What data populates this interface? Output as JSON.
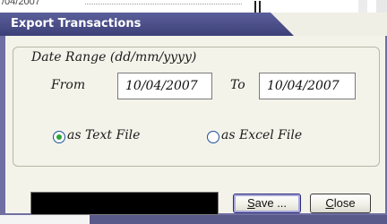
{
  "background": {
    "partial_text": "/04/2007"
  },
  "dialog": {
    "title": "Export Transactions",
    "date_range": {
      "legend": "Date Range (dd/mm/yyyy)",
      "from_label": "From",
      "from_value": "10/04/2007",
      "to_label": "To",
      "to_value": "10/04/2007"
    },
    "format_options": {
      "text_label": "as Text File",
      "text_selected": true,
      "excel_label": "as Excel File",
      "excel_selected": false
    },
    "buttons": {
      "save_prefix": "S",
      "save_rest": "ave ...",
      "close_prefix": "C",
      "close_rest": "lose"
    },
    "colors": {
      "title_bar": "#4a4e88",
      "client_bg": "#f4f3ea",
      "status_box": "#000000",
      "radio_selected": "#2ea43a"
    }
  }
}
